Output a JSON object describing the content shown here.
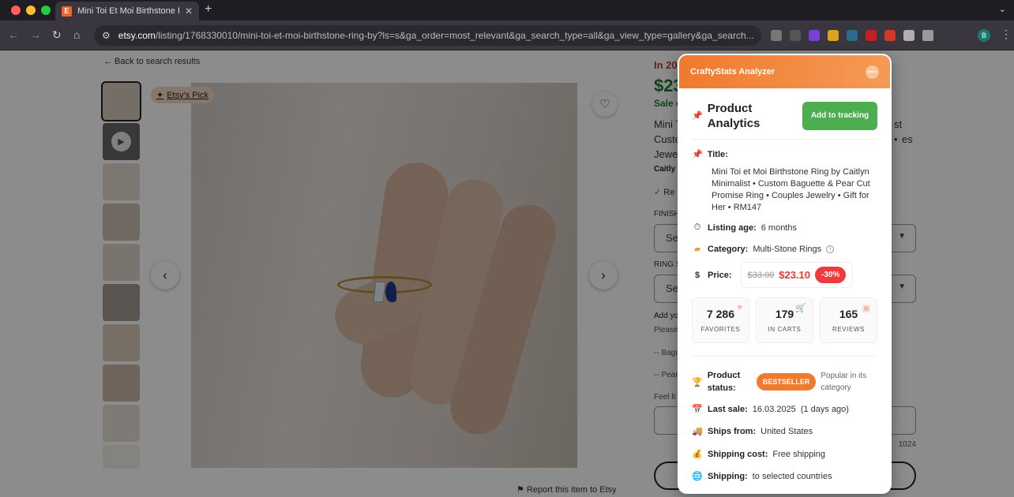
{
  "browser": {
    "tab_title": "Mini Toi Et Moi Birthstone Ring",
    "favicon_letter": "E",
    "url_host": "etsy.com",
    "url_path": "/listing/1768330010/mini-toi-et-moi-birthstone-ring-by?ls=s&ga_order=most_relevant&ga_search_type=all&ga_view_type=gallery&ga_search...",
    "profile_initial": "B"
  },
  "page": {
    "back_link": "← Back to search results",
    "etsys_pick": "Etsy's Pick",
    "report_link": "Report this item to Etsy",
    "right": {
      "demand": "In 20",
      "price": "$23",
      "sale": "Sale e",
      "title_lines": [
        "Mini T",
        "Custo",
        "Jewe"
      ],
      "title_right": [
        "st •",
        "es"
      ],
      "shop": "Caitly",
      "check": "Re",
      "finish_label": "FINISH",
      "select1": "Sele",
      "ring_label": "RING S",
      "select2": "Sele",
      "add_label": "Add yo",
      "please": "Please",
      "bague": "-- Bagu",
      "pear": "-- Pear",
      "feel": "Feel fr",
      "count": "1024"
    }
  },
  "panel": {
    "header": "CraftyStats Analyzer",
    "section_title": "Product Analytics",
    "track_button": "Add to tracking",
    "title_label": "Title:",
    "title_text": "Mini Toi et Moi Birthstone Ring by Caitlyn Minimalist • Custom Baguette & Pear Cut Promise Ring • Couples Jewelry • Gift for Her • RM147",
    "age_label": "Listing age:",
    "age_value": "6 months",
    "category_label": "Category:",
    "category_value": "Multi-Stone Rings",
    "price_label": "Price:",
    "price_old": "$33.00",
    "price_new": "$23.10",
    "discount": "-30%",
    "stats": [
      {
        "value": "7 286",
        "label": "FAVORITES"
      },
      {
        "value": "179",
        "label": "IN CARTS"
      },
      {
        "value": "165",
        "label": "REVIEWS"
      }
    ],
    "status_label": "Product status:",
    "status_badge": "BESTSELLER",
    "status_note": "Popular in its category",
    "last_sale_label": "Last sale:",
    "last_sale_value": "16.03.2025",
    "last_sale_ago": "(1 days ago)",
    "ships_label": "Ships from:",
    "ships_value": "United States",
    "cost_label": "Shipping cost:",
    "cost_value": "Free shipping",
    "shipping_label": "Shipping:",
    "shipping_value": "to selected countries"
  }
}
